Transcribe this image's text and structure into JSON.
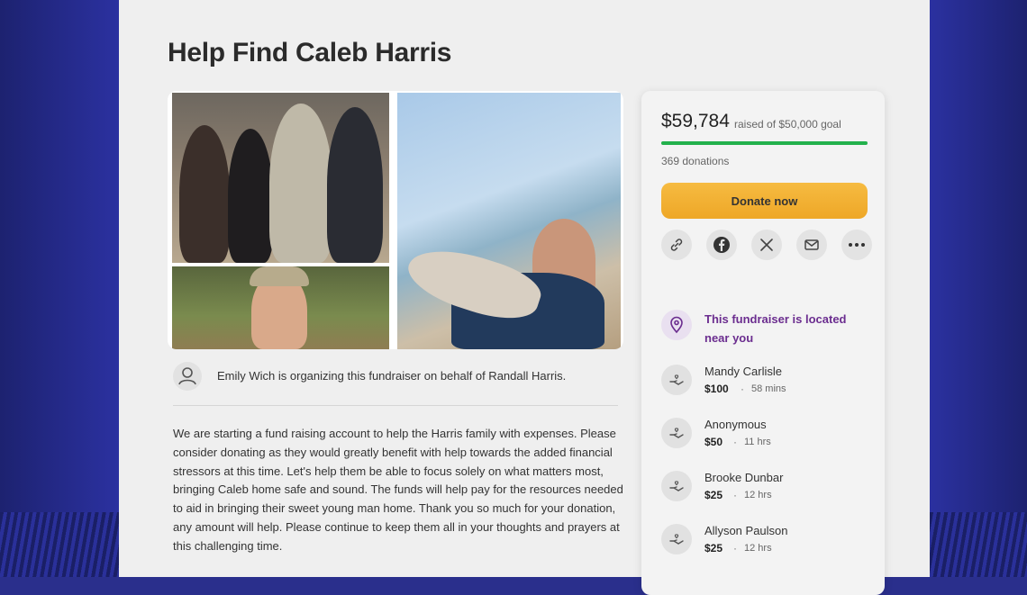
{
  "page": {
    "title": "Help Find Caleb Harris"
  },
  "organizer": {
    "text": "Emily Wich is organizing this fundraiser on behalf of Randall Harris."
  },
  "story": {
    "text": "We are starting a fund raising account to help the Harris family with expenses. Please consider donating as they would greatly benefit with help towards the added financial stressors at this time. Let's help them be able to focus solely on what matters most, bringing Caleb home safe and sound. The funds will help pay for the resources needed to aid in bringing their sweet young man home. Thank you so much for your donation, any amount will help. Please continue to keep them all in your thoughts and prayers at this challenging time."
  },
  "sidebar": {
    "amount_raised": "$59,784",
    "goal_text": "raised of $50,000 goal",
    "progress_percent": 100,
    "donation_count": "369 donations",
    "donate_label": "Donate now",
    "share_icons": [
      "link-icon",
      "facebook-icon",
      "x-icon",
      "mail-icon",
      "more-icon"
    ],
    "location_note": "This fundraiser is located near you",
    "donors": [
      {
        "name": "Mandy Carlisle",
        "amount": "$100",
        "time": "58 mins"
      },
      {
        "name": "Anonymous",
        "amount": "$50",
        "time": "11 hrs"
      },
      {
        "name": "Brooke Dunbar",
        "amount": "$25",
        "time": "12 hrs"
      },
      {
        "name": "Allyson Paulson",
        "amount": "$25",
        "time": "12 hrs"
      }
    ]
  },
  "colors": {
    "accent_green": "#22b14c",
    "donate_button": "#f2b233",
    "location_purple": "#6b2d8f"
  }
}
